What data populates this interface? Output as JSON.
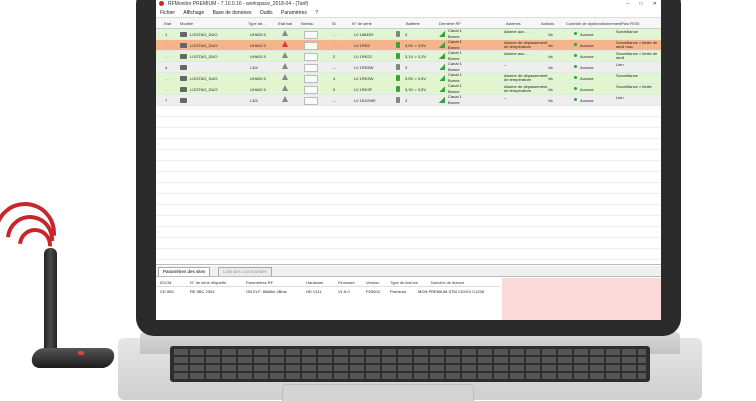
{
  "window": {
    "title": "RFMonitor PREMIUM - 7.10.0.16 - workspace_2018-04 - (Tarif)",
    "controls": [
      "–",
      "□",
      "✕"
    ]
  },
  "menu": [
    "Fichier",
    "Affichage",
    "Base de données",
    "Outils",
    "Paramètres",
    "?"
  ],
  "columns": [
    "Etat",
    "Modèle",
    "Type de...",
    "Etat bat.",
    "Niveau",
    "ID",
    "N° de série",
    "Batterie",
    "Dernière RF",
    "Alarmes",
    "Actions",
    "Contrôle de dysfonctionnement",
    "Plan RSSI"
  ],
  "rows": [
    {
      "num": "1",
      "model": "LOGTAG_DUO",
      "type": "UHADI 5",
      "level": "13%",
      "id": "…",
      "serial": "L0 1884E9",
      "battery": "3",
      "rf": [
        "Canal 1",
        "Bonne"
      ],
      "alarm": "Alarme aux ...",
      "action": "Va",
      "control": "Aucune",
      "plan": "Surveillance",
      "status": "green",
      "alert": "grey"
    },
    {
      "num": "…",
      "model": "LOGTAG_DUO",
      "type": "UHADI 5",
      "level": "–",
      "id": "…",
      "serial": "L0 1RK5",
      "battery": "3,5V > 3,5V",
      "rf": [
        "Canal 1",
        "Bonne"
      ],
      "alarm": "Alarme de dépassement de température",
      "action": "Va",
      "control": "Aucune",
      "plan": "Surveillance > limite de seuil max",
      "status": "orange",
      "alert": "red"
    },
    {
      "num": "…",
      "model": "LOGTAG_DUO",
      "type": "UHADI 5",
      "level": "–",
      "id": "2",
      "serial": "L0 1RK22",
      "battery": "3,1V > 3,3V",
      "rf": [
        "Canal 1",
        "Bonne"
      ],
      "alarm": "Alarme aux ...",
      "action": "Va",
      "control": "Aucune",
      "plan": "Surveillance > limite de seuil",
      "status": "green",
      "alert": "grey"
    },
    {
      "num": "4",
      "model": "",
      "type": "L3/4",
      "level": "",
      "id": "–",
      "serial": "L0 1RK5W",
      "battery": "3",
      "rf": [
        "Canal 1",
        "Bonne"
      ],
      "alarm": "–",
      "action": "Va",
      "control": "Aucune",
      "plan": "Lien",
      "status": "grey",
      "alert": "grey"
    },
    {
      "num": "…",
      "model": "LOGTAG_DUO",
      "type": "UHADI 5",
      "level": "–",
      "id": "4",
      "serial": "L0 1RK3W",
      "battery": "3,5V > 3,5V",
      "rf": [
        "Canal 1",
        "Bonne"
      ],
      "alarm": "Alarme de dépassement de température",
      "action": "Va",
      "control": "Aucune",
      "plan": "Surveillance",
      "status": "green",
      "alert": "grey"
    },
    {
      "num": "…",
      "model": "LOGTAG_DUO",
      "type": "UHADI 5",
      "level": "–",
      "id": "5",
      "serial": "L0 1RK3F",
      "battery": "3,3V > 3,5V",
      "rf": [
        "Canal 1",
        "Bonne"
      ],
      "alarm": "Alarme de dépassement de température",
      "action": "Va",
      "control": "Aucune",
      "plan": "Surveillance > limite",
      "status": "green",
      "alert": "grey"
    },
    {
      "num": "7",
      "model": "",
      "type": "L3/4",
      "level": "",
      "id": "–",
      "serial": "L0 1KK2WE",
      "battery": "3",
      "rf": [
        "Canal 1",
        "Bonne"
      ],
      "alarm": "–",
      "action": "Va",
      "control": "Aucune",
      "plan": "Lien",
      "status": "grey",
      "alert": "grey"
    }
  ],
  "tabs": [
    {
      "label": "Paramètres des sites"
    },
    {
      "label": "Liste des commandes"
    }
  ],
  "detail": {
    "headers": [
      "ID/CM",
      "N° de série étiquette",
      "Paramètres RF",
      "Hardware",
      "Firmware",
      "Version",
      "Type de licence",
      "Numéro de licence"
    ],
    "values": [
      "CD 983",
      "RE 9BC 2303",
      "ON ELF: 86dBm 2Bms",
      "HD V111",
      "V1.6.0",
      "P2500C",
      "Premium",
      "MON PREMIUM STM C0XXX C1208"
    ]
  },
  "colors": {
    "green_row": "#e0f5d2",
    "orange_row": "#f5b48a",
    "grey_row": "#eeeeee",
    "brand_red": "#c9262b"
  }
}
